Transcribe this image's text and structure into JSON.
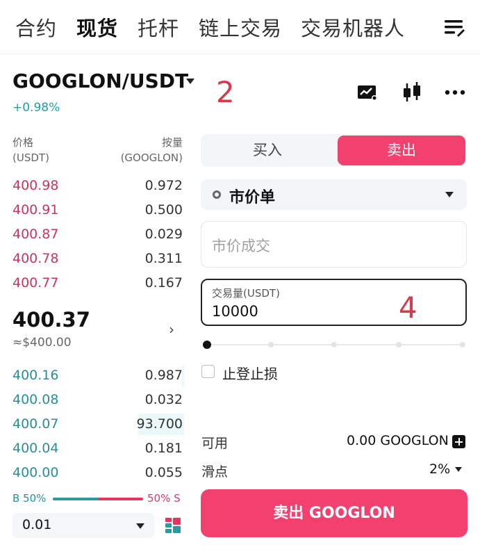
{
  "topnav": {
    "tabs": [
      {
        "label": "合约"
      },
      {
        "label": "现货"
      },
      {
        "label": "托杆"
      },
      {
        "label": "链上交易"
      },
      {
        "label": "交易机器人"
      }
    ],
    "active": "现货",
    "menu_icon": "menu-lines-icon"
  },
  "header": {
    "pair": "GOOGLON/USDT",
    "change": "+0.98%",
    "annotation": "2",
    "icons": [
      "chart-icon",
      "candlestick-icon",
      "more-icon"
    ]
  },
  "orderbook": {
    "price_label": "价格",
    "price_unit": "(USDT)",
    "qty_label": "按量",
    "qty_unit": "(GOOGLON)",
    "asks": [
      {
        "price": "400.98",
        "qty": "0.972"
      },
      {
        "price": "400.91",
        "qty": "0.500"
      },
      {
        "price": "400.87",
        "qty": "0.029"
      },
      {
        "price": "400.78",
        "qty": "0.311"
      },
      {
        "price": "400.77",
        "qty": "0.167"
      }
    ],
    "last_price": "400.37",
    "last_fiat": "≈$400.00",
    "bids": [
      {
        "price": "400.16",
        "qty": "0.987",
        "depth": 0.01
      },
      {
        "price": "400.08",
        "qty": "0.032",
        "depth": 0.0
      },
      {
        "price": "400.07",
        "qty": "93.700",
        "depth": 0.25
      },
      {
        "price": "400.04",
        "qty": "0.181",
        "depth": 0.0
      },
      {
        "price": "400.00",
        "qty": "0.055",
        "depth": 0.0
      }
    ],
    "buy_ratio_label": "B 50%",
    "sell_ratio_label": "50% S",
    "buy_ratio": 0.5,
    "precision": "0.01",
    "layout_icon": "orderbook-layout-icon"
  },
  "form": {
    "buy_label": "买入",
    "sell_label": "卖出",
    "order_type": "市价单",
    "price_placeholder": "市价成交",
    "amount_label": "交易量(USDT)",
    "amount_value": "10000",
    "annotation": "4",
    "slider_value": 0,
    "tpsl_label": "止登止损",
    "available_label": "可用",
    "available_value": "0.00 GOOGLON",
    "slippage_label": "滑点",
    "slippage_value": "2%",
    "submit_label": "卖出 GOOGLON"
  },
  "colors": {
    "sell": "#f2416f",
    "ask_price": "#c8375a",
    "bid_price": "#2a8f94",
    "change": "#1f9fa2"
  }
}
